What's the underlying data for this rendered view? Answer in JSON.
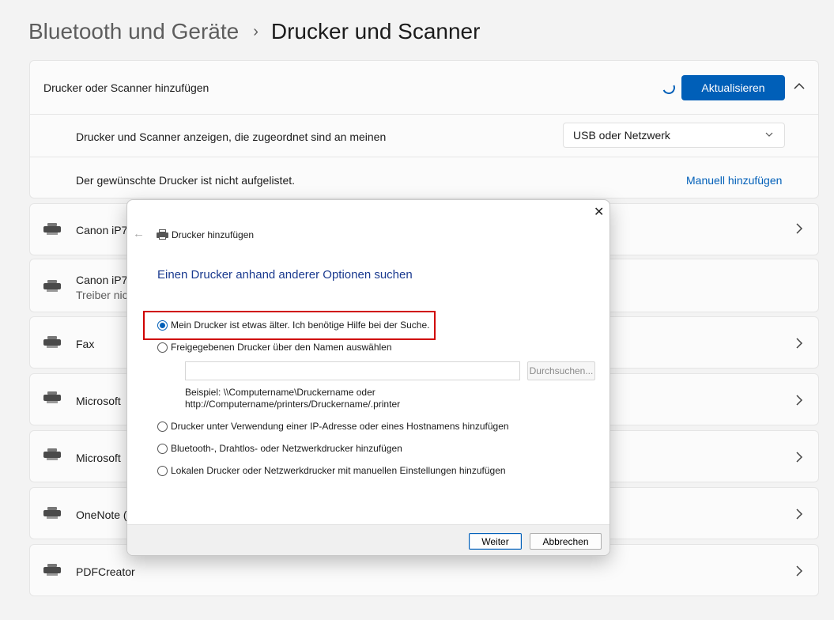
{
  "breadcrumb": {
    "parent": "Bluetooth und Geräte",
    "separator": "›",
    "current": "Drucker und Scanner"
  },
  "add_section": {
    "title": "Drucker oder Scanner hinzufügen",
    "refresh_label": "Aktualisieren",
    "collapse_glyph": "^",
    "filter_text": "Drucker und Scanner anzeigen, die zugeordnet sind an meinen",
    "filter_value": "USB oder Netzwerk",
    "missing_text": "Der gewünschte Drucker ist nicht aufgelistet.",
    "manual_link": "Manuell hinzufügen"
  },
  "devices": [
    {
      "name": "Canon iP7",
      "sub": "",
      "icon": "printer-icon"
    },
    {
      "name": "Canon iP7",
      "sub": "Treiber nic",
      "icon": "printer-icon"
    },
    {
      "name": "Fax",
      "sub": "",
      "icon": "fax-icon"
    },
    {
      "name": "Microsoft",
      "sub": "",
      "icon": "printer-doc-icon"
    },
    {
      "name": "Microsoft",
      "sub": "",
      "icon": "printer-doc-icon"
    },
    {
      "name": "OneNote (",
      "sub": "",
      "icon": "printer-icon"
    },
    {
      "name": "PDFCreator",
      "sub": "",
      "icon": "printer-icon"
    }
  ],
  "dialog": {
    "title": "Drucker hinzufügen",
    "heading": "Einen Drucker anhand anderer Optionen suchen",
    "options": [
      "Mein Drucker ist etwas älter. Ich benötige Hilfe bei der Suche.",
      "Freigegebenen Drucker über den Namen auswählen",
      "Drucker unter Verwendung einer IP-Adresse oder eines Hostnamens hinzufügen",
      "Bluetooth-, Drahtlos- oder Netzwerkdrucker hinzufügen",
      "Lokalen Drucker oder Netzwerkdrucker mit manuellen Einstellungen hinzufügen"
    ],
    "selected_option": 0,
    "share_input_value": "",
    "browse_label": "Durchsuchen...",
    "example_line1": "Beispiel: \\\\Computername\\Druckername oder",
    "example_line2": "http://Computername/printers/Druckername/.printer",
    "next_label": "Weiter",
    "cancel_label": "Abbrechen",
    "close_glyph": "✕",
    "back_glyph": "←"
  },
  "colors": {
    "accent": "#005fb8",
    "highlight_box": "#d00000",
    "heading": "#1a3a8f"
  }
}
